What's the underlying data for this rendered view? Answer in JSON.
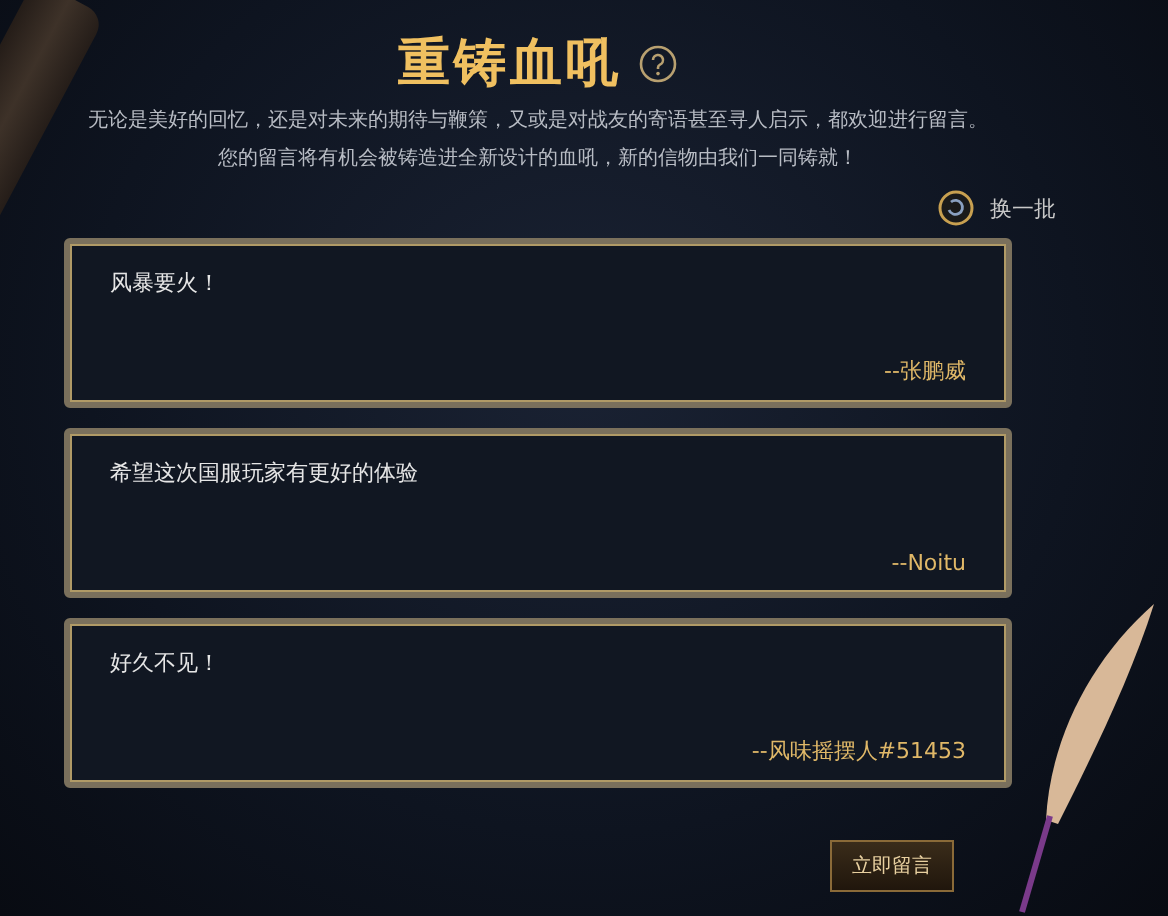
{
  "header": {
    "title": "重铸血吼",
    "description": [
      "无论是美好的回忆，还是对未来的期待与鞭策，又或是对战友的寄语甚至寻人启示，都欢迎进行留言。",
      "您的留言将有机会被铸造进全新设计的血吼，新的信物由我们一同铸就！"
    ]
  },
  "refresh": {
    "label": "换一批"
  },
  "messages": [
    {
      "text": "风暴要火！",
      "author": "--张鹏威"
    },
    {
      "text": "希望这次国服玩家有更好的体验",
      "author": "--Noitu"
    },
    {
      "text": "好久不见！",
      "author": "--风味摇摆人#51453"
    }
  ],
  "submit": {
    "label": "立即留言"
  }
}
